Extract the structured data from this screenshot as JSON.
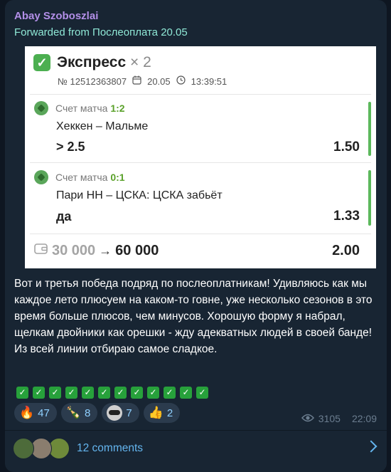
{
  "message": {
    "author": "Abay Szoboszlai",
    "forwarded": "Forwarded from Послеоплата 20.05"
  },
  "bet_card": {
    "title": "Экспресс",
    "multiplier": "× 2",
    "bet_id": "№ 12512363807",
    "date": "20.05",
    "time": "13:39:51",
    "bets": [
      {
        "market": "Счет матча",
        "score": "1:2",
        "event": "Хеккен – Мальме",
        "outcome": "> 2.5",
        "odds": "1.50"
      },
      {
        "market": "Счет матча",
        "score": "0:1",
        "event": "Пари НН – ЦСКА: ЦСКА забьёт",
        "outcome": "да",
        "odds": "1.33"
      }
    ],
    "stake": "30 000",
    "payout": "60 000",
    "total_odds": "2.00",
    "accent_color": "#4caf50"
  },
  "text": "Вот и третья победа подряд по послеоплатникам! Удивляюсь как мы каждое лето плюсуем на каком-то говне, уже несколько сезонов в это время больше плюсов, чем минусов. Хорошую форму я набрал, щелкам двойники как орешки - жду адекватных людей в своей банде! Из всей линии отбираю самое сладкое.",
  "checkmarks": [
    "✓",
    "✓",
    "✓",
    "✓",
    "✓",
    "✓",
    "✓",
    "✓",
    "✓",
    "✓",
    "✓",
    "✓"
  ],
  "reactions": [
    {
      "emoji": "🔥",
      "count": "47"
    },
    {
      "emoji": "🍾",
      "count": "8"
    },
    {
      "emoji": "custom-sticker",
      "count": "7"
    },
    {
      "emoji": "👍",
      "count": "2"
    }
  ],
  "views": "3105",
  "time": "22:09",
  "comments_label": "12 comments"
}
